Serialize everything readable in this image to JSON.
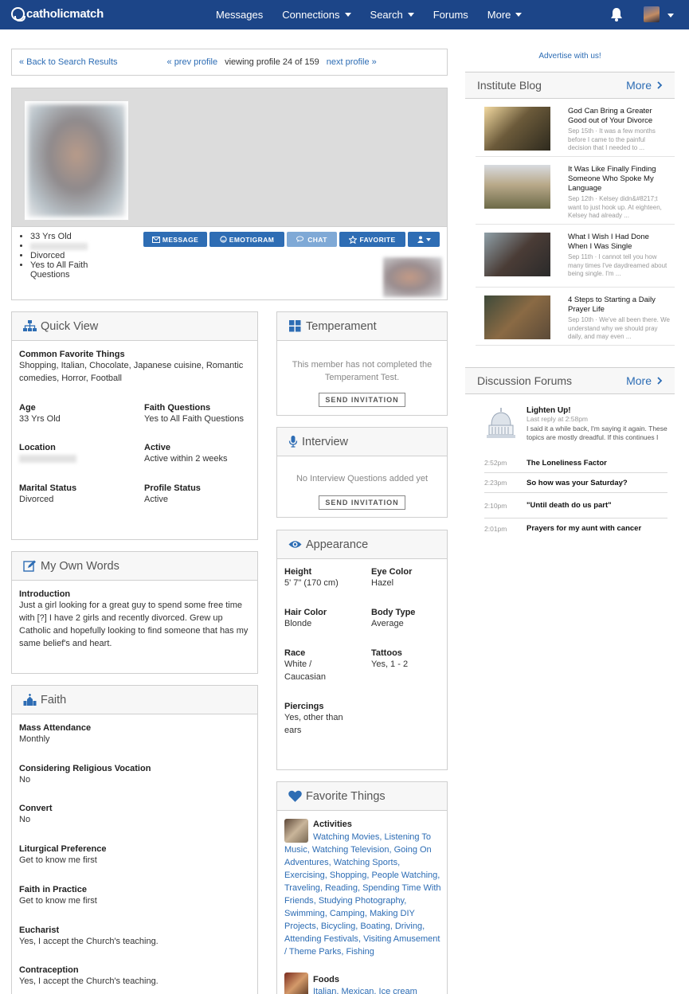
{
  "nav": {
    "logo": "catholicmatch",
    "links": [
      {
        "label": "Messages",
        "dropdown": false
      },
      {
        "label": "Connections",
        "dropdown": true
      },
      {
        "label": "Search",
        "dropdown": true
      },
      {
        "label": "Forums",
        "dropdown": false
      },
      {
        "label": "More",
        "dropdown": true
      }
    ],
    "bg_color": "#1c4588"
  },
  "profile_nav": {
    "back": "« Back to Search Results",
    "prev": "« prev profile",
    "viewing": "viewing profile 24 of 159",
    "next": "next profile »"
  },
  "profile": {
    "bullets": [
      "33 Yrs Old",
      "",
      "Divorced",
      "Yes to All Faith Questions"
    ],
    "buttons": [
      "MESSAGE",
      "EMOTIGRAM",
      "CHAT",
      "FAVORITE"
    ]
  },
  "quick_view": {
    "title": "Quick View",
    "common_label": "Common Favorite Things",
    "common_value": "Shopping, Italian, Chocolate, Japanese cuisine, Romantic comedies, Horror, Football",
    "age_label": "Age",
    "age_value": "33 Yrs Old",
    "faithq_label": "Faith Questions",
    "faithq_value": "Yes to All Faith Questions",
    "location_label": "Location",
    "active_label": "Active",
    "active_value": "Active within 2 weeks",
    "marital_label": "Marital Status",
    "marital_value": "Divorced",
    "status_label": "Profile Status",
    "status_value": "Active"
  },
  "own_words": {
    "title": "My Own Words",
    "intro_label": "Introduction",
    "intro_text": "Just a girl looking for a great guy to spend some free time with [?] I have 2 girls and recently divorced. Grew up Catholic and hopefully looking to find someone that has my same belief's and heart."
  },
  "faith": {
    "title": "Faith",
    "items": [
      {
        "label": "Mass Attendance",
        "value": "Monthly"
      },
      {
        "label": "Considering Religious Vocation",
        "value": "No"
      },
      {
        "label": "Convert",
        "value": "No"
      },
      {
        "label": "Liturgical Preference",
        "value": "Get to know me first"
      },
      {
        "label": "Faith in Practice",
        "value": "Get to know me first"
      },
      {
        "label": "Eucharist",
        "value": "Yes, I accept the Church's teaching."
      },
      {
        "label": "Contraception",
        "value": "Yes, I accept the Church's teaching."
      }
    ]
  },
  "temperament": {
    "title": "Temperament",
    "text": "This member has not completed the Temperament Test.",
    "button": "SEND INVITATION"
  },
  "interview": {
    "title": "Interview",
    "text": "No Interview Questions added yet",
    "button": "SEND INVITATION"
  },
  "appearance": {
    "title": "Appearance",
    "items": [
      {
        "label": "Height",
        "value": "5' 7\" (170 cm)"
      },
      {
        "label": "Eye Color",
        "value": "Hazel"
      },
      {
        "label": "Hair Color",
        "value": "Blonde"
      },
      {
        "label": "Body Type",
        "value": "Average"
      },
      {
        "label": "Race",
        "value": "White / Caucasian"
      },
      {
        "label": "Tattoos",
        "value": "Yes, 1 - 2"
      },
      {
        "label": "Piercings",
        "value": "Yes, other than ears"
      }
    ]
  },
  "favorite_things": {
    "title": "Favorite Things",
    "activities_label": "Activities",
    "activities": [
      "Watching Movies",
      "Listening To Music",
      "Watching Television",
      "Going On Adventures",
      "Watching Sports",
      "Exercising",
      "Shopping",
      "People Watching",
      "Traveling",
      "Reading",
      "Spending Time With Friends",
      "Studying Photography",
      "Swimming",
      "Camping",
      "Making DIY Projects",
      "Bicycling",
      "Boating",
      "Driving",
      "Attending Festivals",
      "Visiting Amusement / Theme Parks",
      "Fishing"
    ],
    "foods_label": "Foods",
    "foods_text": "Italian, Mexican, Ice cream"
  },
  "sidebar": {
    "advertise": "Advertise with us!",
    "blog": {
      "title": "Institute Blog",
      "more": "More",
      "posts": [
        {
          "title": "God Can Bring a Greater Good out of Your Divorce",
          "meta": "Sep 15th · It was a few months before I came to the painful decision that I needed to ..."
        },
        {
          "title": "It Was Like Finally Finding Someone Who Spoke My Language",
          "meta": "Sep 12th · Kelsey didn&#8217;t want to just hook up. At eighteen, Kelsey had already ..."
        },
        {
          "title": "What I Wish I Had Done When I Was Single",
          "meta": "Sep 11th · I cannot tell you how many times I've daydreamed about being single. I'm ..."
        },
        {
          "title": "4 Steps to Starting a Daily Prayer Life",
          "meta": "Sep 10th · We've all been there. We understand why we should pray daily, and may even ..."
        }
      ]
    },
    "forums": {
      "title": "Discussion Forums",
      "more": "More",
      "featured_title": "Lighten Up!",
      "featured_meta": "Last reply at 2:58pm",
      "featured_text": "I said it a while back, I'm saying it again. These topics are mostly dreadful. If this continues I",
      "topics": [
        {
          "time": "2:52pm",
          "title": "The Loneliness Factor"
        },
        {
          "time": "2:23pm",
          "title": "So how was your Saturday?"
        },
        {
          "time": "2:10pm",
          "title": "\"Until death do us part\""
        },
        {
          "time": "2:01pm",
          "title": "Prayers for my aunt with cancer"
        }
      ]
    }
  }
}
